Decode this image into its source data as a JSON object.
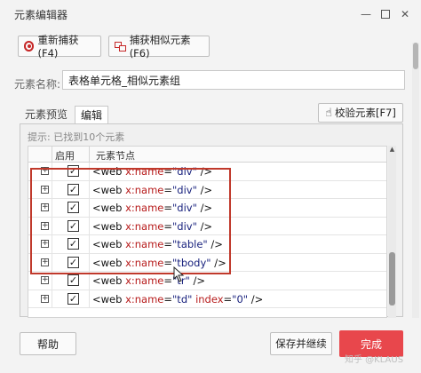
{
  "window": {
    "title": "元素编辑器",
    "minimize_glyph": "—",
    "close_glyph": "✕"
  },
  "toolbar": {
    "recapture_label": "重新捕获(F4)",
    "capture_similar_label": "捕获相似元素(F6)"
  },
  "element_name": {
    "label": "元素名称:",
    "value": "表格单元格_相似元素组"
  },
  "tabs": [
    {
      "label": "元素预览",
      "active": false
    },
    {
      "label": "编辑",
      "active": true
    }
  ],
  "verify_button": {
    "label": "校验元素[F7]"
  },
  "hint": "提示: 已找到10个元素",
  "grid": {
    "columns": [
      "启用",
      "元素节点"
    ],
    "rows": [
      {
        "tag": "<web",
        "attr": "x:name",
        "value": "\"div\"",
        "extra_attr": "",
        "extra_value": "",
        "close": "/>",
        "enabled": true
      },
      {
        "tag": "<web",
        "attr": "x:name",
        "value": "\"div\"",
        "extra_attr": "",
        "extra_value": "",
        "close": "/>",
        "enabled": true
      },
      {
        "tag": "<web",
        "attr": "x:name",
        "value": "\"div\"",
        "extra_attr": "",
        "extra_value": "",
        "close": "/>",
        "enabled": true
      },
      {
        "tag": "<web",
        "attr": "x:name",
        "value": "\"div\"",
        "extra_attr": "",
        "extra_value": "",
        "close": "/>",
        "enabled": true
      },
      {
        "tag": "<web",
        "attr": "x:name",
        "value": "\"table\"",
        "extra_attr": "",
        "extra_value": "",
        "close": "/>",
        "enabled": true
      },
      {
        "tag": "<web",
        "attr": "x:name",
        "value": "\"tbody\"",
        "extra_attr": "",
        "extra_value": "",
        "close": "/>",
        "enabled": true
      },
      {
        "tag": "<web",
        "attr": "x:name",
        "value": "\"tr\"",
        "extra_attr": "",
        "extra_value": "",
        "close": "/>",
        "enabled": true
      },
      {
        "tag": "<web",
        "attr": "x:name",
        "value": "\"td\"",
        "extra_attr": "index",
        "extra_value": "\"0\"",
        "close": "/>",
        "enabled": true
      }
    ],
    "expand_glyph": "+",
    "check_glyph": "✓"
  },
  "footer": {
    "help_label": "帮助",
    "save_continue_label": "保存并继续",
    "done_label": "完成",
    "watermark": "知乎 @KLAUS"
  },
  "colors": {
    "highlight": "#c0392b",
    "done_button": "#e8474c",
    "attr_name": "#b71c1c",
    "attr_value": "#1a237e"
  },
  "icons": {
    "recapture": "target-icon",
    "similar": "similar-elements-icon",
    "verify": "hand-pointer-icon"
  }
}
